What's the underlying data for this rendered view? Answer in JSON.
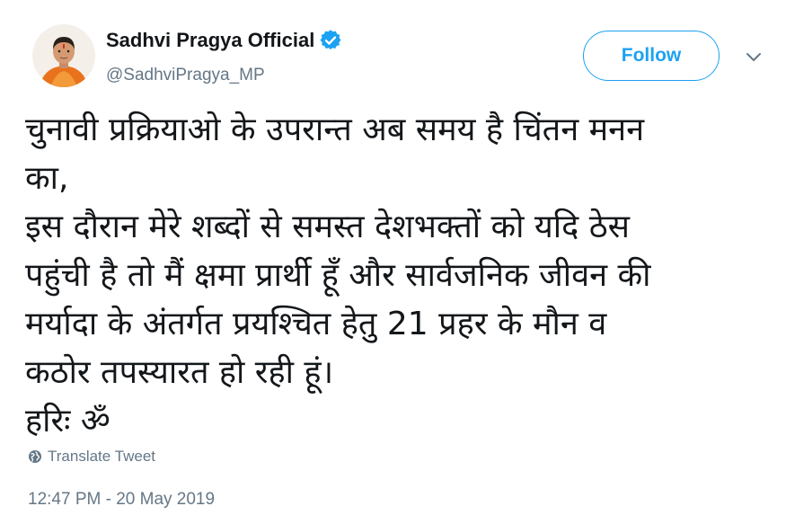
{
  "author": {
    "display_name": "Sadhvi Pragya Official",
    "handle": "@SadhviPragya_MP",
    "verified": true,
    "avatar_icon": "profile-photo"
  },
  "actions": {
    "follow_label": "Follow",
    "more_icon": "chevron-down-icon"
  },
  "tweet": {
    "lines": [
      "चुनावी प्रक्रियाओ के उपरान्त अब समय है चिंतन मनन",
      "का,",
      "इस दौरान मेरे शब्दों से समस्त देशभक्तों को यदि ठेस",
      "पहुंची है तो मैं क्षमा प्रार्थी हूँ और सार्वजनिक जीवन की",
      "मर्यादा के अंतर्गत प्रयश्चित हेतु 21 प्रहर के मौन व",
      "कठोर तपस्यारत हो रही हूं।",
      "हरिः ॐ"
    ]
  },
  "translate": {
    "label": "Translate Tweet",
    "icon": "globe-icon"
  },
  "timestamp": "12:47 PM - 20 May 2019",
  "colors": {
    "accent": "#1da1f2",
    "text": "#14171a",
    "secondary": "#657786"
  }
}
